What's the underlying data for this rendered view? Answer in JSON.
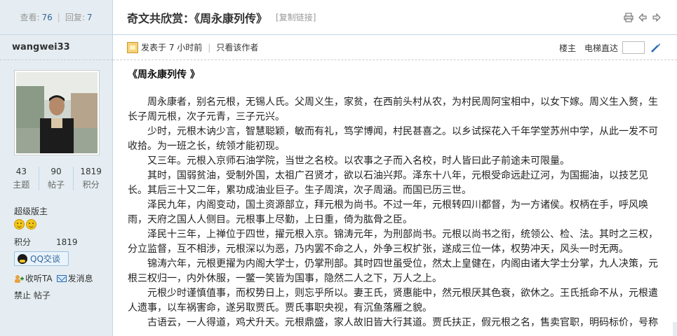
{
  "stats": {
    "views_label": "查看:",
    "views": "76",
    "replies_label": "回复:",
    "replies": "7"
  },
  "thread": {
    "title": "奇文共欣赏：《周永康列传》",
    "copy_link": "[复制链接]"
  },
  "user": {
    "name": "wangwei33",
    "stats": [
      {
        "value": "43",
        "label": "主题"
      },
      {
        "value": "90",
        "label": "帖子"
      },
      {
        "value": "1819",
        "label": "积分"
      }
    ],
    "level": "超级版主",
    "points_label": "积分",
    "points_value": "1819",
    "qq_button": "QQ交谈",
    "follow_label": "收听TA",
    "message_label": "发消息",
    "ban_label": "禁止",
    "posts_label": "帖子"
  },
  "meta": {
    "posted": "发表于 7 小时前",
    "only_author": "只看该作者",
    "floor": "楼主",
    "elevator": "电梯直达"
  },
  "post": {
    "title": "《周永康列传 》",
    "paragraphs": [
      "　　周永康者，别名元根，无锡人氏。父周义生，家贫，在西前头村从农，为村民周阿宝相中，以女下嫁。周义生入赘，生长子周元根，次子元青，三子元兴。",
      "　　少时，元根木讷少言，智慧聪颖，敏而有礼，笃学博闻，村民甚喜之。以乡试探花入千年学堂苏州中学，从此一发不可收拾。为一班之长，统领才能初现。",
      "　　又三年。元根入京师石油学院，当世之名校。以农事之子而入名校，时人皆曰此子前途未可限量。",
      "　　其时，国弱贫油，受制外国，太祖广召贤才，欲以石油兴邦。泽东十八年，元根受命远赴辽河，为国掘油，以技艺见长。其后三十又二年，累功成油业巨子。生子周滨，次子周涵。而国已历三世。",
      "　　泽民九年，内阁变动，国土资源部立，拜元根为尚书。不过一年，元根转四川都督，为一方诸侯。权柄在手，呼风唤雨，天府之国人人侧目。元根事上尽勤，上日重，倚为肱骨之臣。",
      "　　泽民十三年，上禅位于四世，擢元根入京。锦涛元年，为刑部尚书。元根以尚书之衔，统领公、检、法。其时之三权，分立监督，互不相涉，元根深以为恶，乃内罢不命之人，外争三权扩张，遂成三位一体，权势冲天，风头一时无两。",
      "　　锦涛六年，元根更擢为内阁大学士，仍掌刑部。其时四世虽受位，然太上皇健在，内阁由诸大学士分掌，九人决策，元根三权归一，内外休服，一鳖一笑皆为国事，隐然二人之下，万人之上。",
      "　　元根少时谨慎值事，而权势日上，则忘乎所以。妻王氏，贤惠能中，然元根厌其色衰，欲休之。王氏抵命不从，元根遣人遗事，以车祸害命，遂另取贾氏。贾氏事职央视，有沉鱼落雁之貌。",
      "　　古语云，一人得道，鸡犬升天。元根鼎盛，家人故旧皆大行其道。贾氏扶正，假元根之名，售卖官职，明码标价，号称"
    ]
  }
}
